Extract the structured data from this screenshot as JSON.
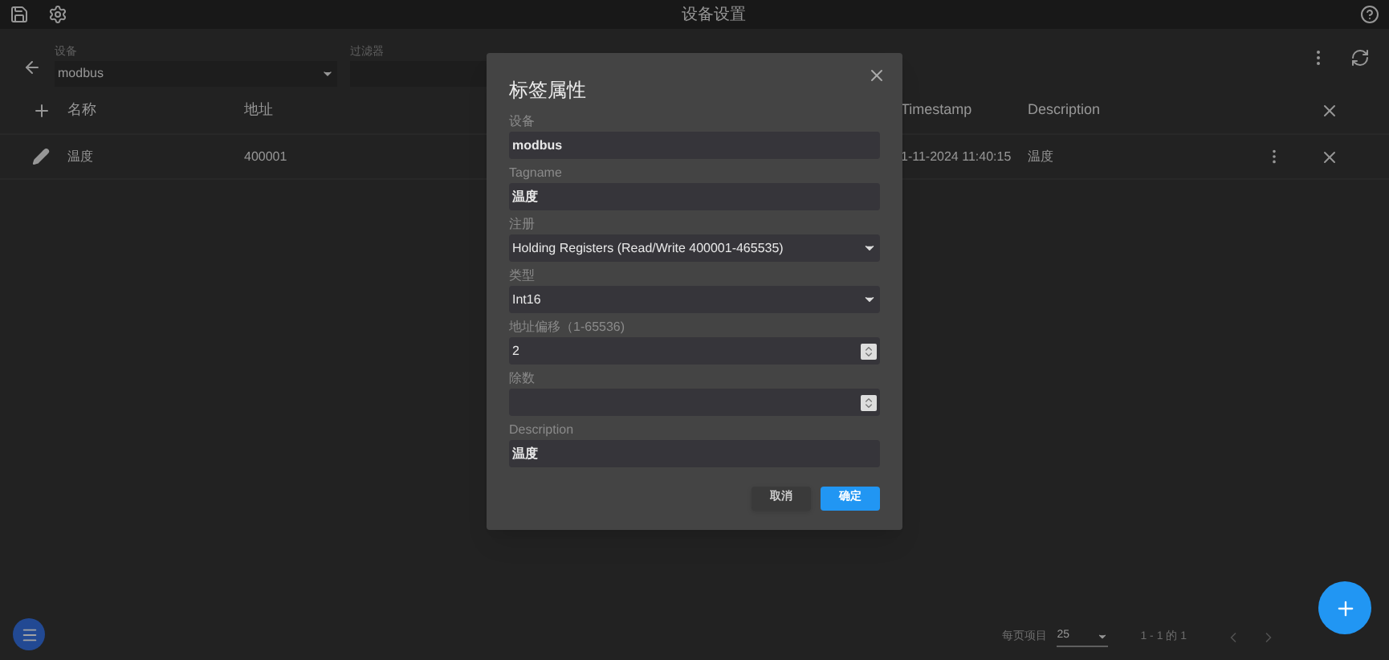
{
  "app_bar": {
    "title": "设备设置"
  },
  "toolbar": {
    "device": {
      "label": "设备",
      "value": "modbus"
    },
    "filter": {
      "label": "过滤器"
    }
  },
  "table": {
    "columns": [
      "名称",
      "地址",
      "Timestamp",
      "Description"
    ],
    "rows": [
      {
        "name": "温度",
        "address": "400001",
        "timestamp": "1-11-2024 11:40:15",
        "description": "温度"
      }
    ]
  },
  "pagination": {
    "label": "每页项目",
    "per_page": "25",
    "range": "1 - 1 的 1"
  },
  "dialog": {
    "title": "标签属性",
    "fields": [
      {
        "kind": "text",
        "label": "设备",
        "value": "modbus",
        "bold": true
      },
      {
        "kind": "text",
        "label": "Tagname",
        "value": "温度",
        "bold": true
      },
      {
        "kind": "select",
        "label": "注册",
        "value": "Holding Registers (Read/Write 400001-465535)",
        "bold": false
      },
      {
        "kind": "select",
        "label": "类型",
        "value": "Int16",
        "bold": false
      },
      {
        "kind": "number",
        "label": "地址偏移（1-65536)",
        "value": "2",
        "bold": false
      },
      {
        "kind": "number",
        "label": "除数"
      },
      {
        "kind": "text",
        "label": "Description",
        "value": "温度",
        "bold": true
      }
    ],
    "buttons": [
      {
        "label": "取消",
        "primary": false
      },
      {
        "label": "确定",
        "primary": true
      }
    ]
  }
}
